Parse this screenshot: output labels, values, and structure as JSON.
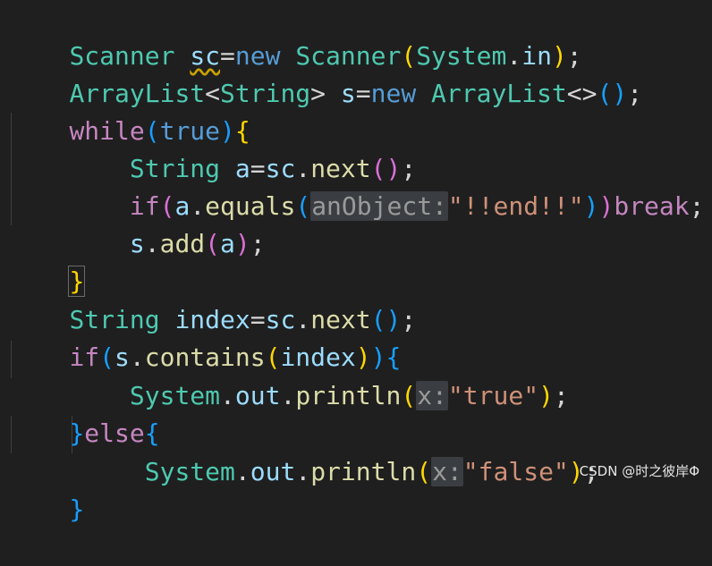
{
  "code": {
    "line1": {
      "t1": "Scanner",
      "t2": " ",
      "t3": "sc",
      "t4": "=",
      "t5": "new",
      "t6": " ",
      "t7": "Scanner",
      "t8": "(",
      "t9": "System",
      "t10": ".",
      "t11": "in",
      "t12": ")",
      "t13": ";"
    },
    "line2": {
      "t1": "ArrayList",
      "t2": "<",
      "t3": "String",
      "t4": ">",
      "t5": " ",
      "t6": "s",
      "t7": "=",
      "t8": "new",
      "t9": " ",
      "t10": "ArrayList",
      "t11": "<>",
      "t12": "()",
      "t13": ";"
    },
    "line3": {
      "t1": "while",
      "t2": "(",
      "t3": "true",
      "t4": ")",
      "t5": "{"
    },
    "line4": {
      "t1": "    ",
      "t2": "String",
      "t3": " ",
      "t4": "a",
      "t5": "=",
      "t6": "sc",
      "t7": ".",
      "t8": "next",
      "t9": "()",
      "t10": ";"
    },
    "line5": {
      "t1": "    ",
      "t2": "if",
      "t3": "(",
      "t4": "a",
      "t5": ".",
      "t6": "equals",
      "t7": "(",
      "hint": "anObject:",
      "t8": "\"!!end!!\"",
      "t9": ")",
      "t10": ")",
      "t11": "break",
      "t12": ";"
    },
    "line6": {
      "t1": "    ",
      "t2": "s",
      "t3": ".",
      "t4": "add",
      "t5": "(",
      "t6": "a",
      "t7": ")",
      "t8": ";"
    },
    "line7": {
      "t1": "}"
    },
    "line8": {
      "t1": "String",
      "t2": " ",
      "t3": "index",
      "t4": "=",
      "t5": "sc",
      "t6": ".",
      "t7": "next",
      "t8": "()",
      "t9": ";"
    },
    "line9": {
      "t1": "if",
      "t2": "(",
      "t3": "s",
      "t4": ".",
      "t5": "contains",
      "t6": "(",
      "t7": "index",
      "t8": ")",
      "t9": ")",
      "t10": "{"
    },
    "line10": {
      "t1": "    ",
      "t2": "System",
      "t3": ".",
      "t4": "out",
      "t5": ".",
      "t6": "println",
      "t7": "(",
      "hint": "x:",
      "t8": "\"true\"",
      "t9": ")",
      "t10": ";"
    },
    "line11": {
      "t1": "}",
      "t2": "else",
      "t3": "{"
    },
    "line12": {
      "t1": "     ",
      "t2": "System",
      "t3": ".",
      "t4": "out",
      "t5": ".",
      "t6": "println",
      "t7": "(",
      "hint": "x:",
      "t8": "\"false\"",
      "t9": ")",
      "t10": ";"
    },
    "line13": {
      "t1": "}"
    }
  },
  "watermark": "CSDN @时之彼岸Φ"
}
